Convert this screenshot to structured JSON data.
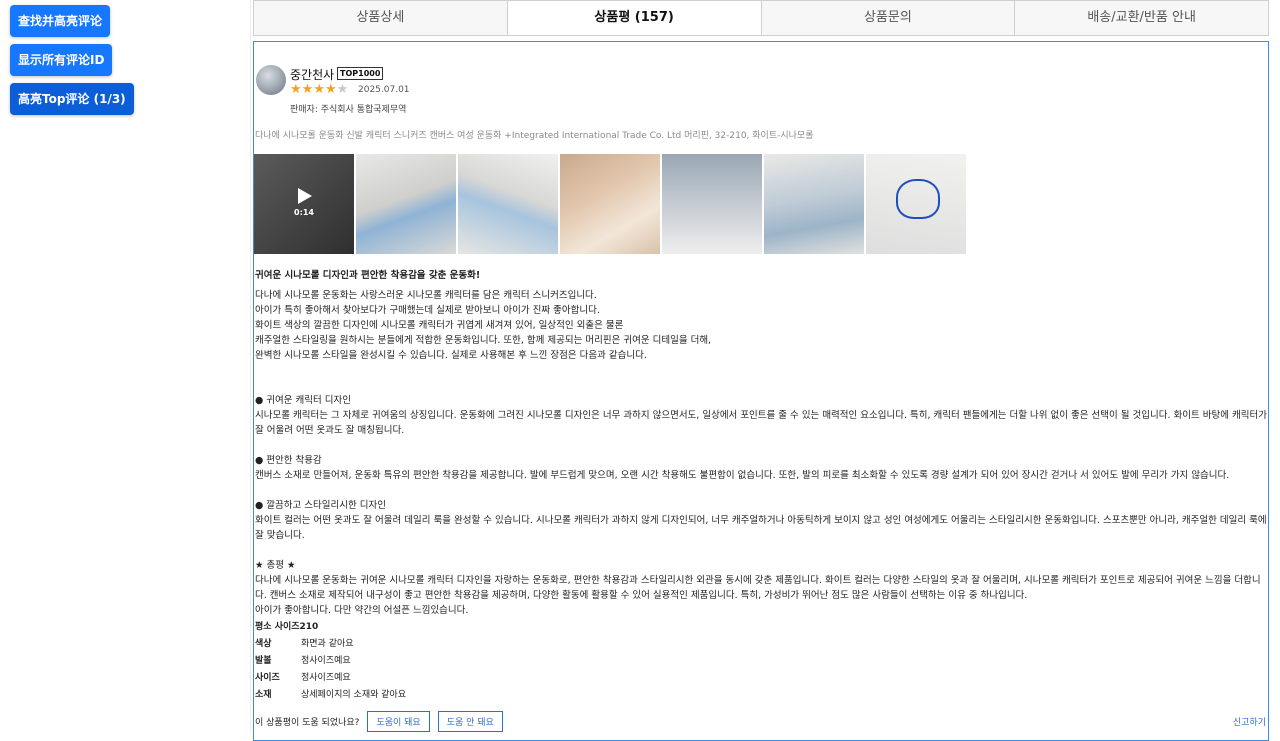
{
  "toolbar": {
    "find_btn": "查找并高亮评论",
    "show_ids_btn": "显示所有评论ID",
    "top_btn": "高亮Top评论 (1/3)"
  },
  "tabs": [
    {
      "label": "상품상세"
    },
    {
      "label": "상품평 (157)"
    },
    {
      "label": "상품문의"
    },
    {
      "label": "배송/교환/반품 안내"
    }
  ],
  "review": {
    "author": "중간천사",
    "badge": "TOP1000",
    "rating": 4,
    "date": "2025.07.01",
    "seller": "판매자: 주식회사 통합국제무역",
    "product_option": "다나에 시나모롤 운동화 신발 캐릭터 스니커즈 캔버스 여성 운동화 +Integrated International Trade Co. Ltd 머리핀, 32-210, 화이트-시나모롤",
    "video_time": "0:14",
    "headline": "귀여운 시나모롤 디자인과 편안한 착용감을 갖춘 운동화!",
    "body": "다나에 시나모롤 운동화는 사랑스러운 시나모롤 캐릭터를 담은 캐릭터 스니커즈입니다.\n아이가 특히 좋아해서 찾아보다가 구매했는데 실제로 받아보니 아이가 진짜 좋아합니다.\n화이트 색상의 깔끔한 디자인에 시나모롤 캐릭터가 귀엽게 새겨져 있어, 일상적인 외출은 물론\n캐주얼한 스타일링을 원하시는 분들에게 적합한 운동화입니다. 또한, 함께 제공되는 머리핀은 귀여운 디테일을 더해,\n완벽한 시나모롤 스타일을 완성시킬 수 있습니다. 실제로 사용해본 후 느낀 장점은 다음과 같습니다.\n\n\n● 귀여운 캐릭터 디자인\n시나모롤 캐릭터는 그 자체로 귀여움의 상징입니다. 운동화에 그려진 시나모롤 디자인은 너무 과하지 않으면서도, 일상에서 포인트를 줄 수 있는 매력적인 요소입니다. 특히, 캐릭터 팬들에게는 더할 나위 없이 좋은 선택이 될 것입니다. 화이트 바탕에 캐릭터가 잘 어울려 어떤 옷과도 잘 매칭됩니다.\n\n● 편안한 착용감\n캔버스 소재로 만들어져, 운동화 특유의 편안한 착용감을 제공합니다. 발에 부드럽게 맞으며, 오랜 시간 착용해도 불편함이 없습니다. 또한, 발의 피로를 최소화할 수 있도록 경량 설계가 되어 있어 장시간 걷거나 서 있어도 발에 무리가 가지 않습니다.\n\n● 깔끔하고 스타일리시한 디자인\n화이트 컬러는 어떤 옷과도 잘 어울려 데일리 룩을 완성할 수 있습니다. 시나모롤 캐릭터가 과하지 않게 디자인되어, 너무 캐주얼하거나 아동틱하게 보이지 않고 성인 여성에게도 어울리는 스타일리시한 운동화입니다. 스포츠뿐만 아니라, 캐주얼한 데일리 룩에 잘 맞습니다.\n\n★ 총평 ★\n다나에 시나모롤 운동화는 귀여운 시나모롤 캐릭터 디자인을 자랑하는 운동화로, 편안한 착용감과 스타일리시한 외관을 동시에 갖춘 제품입니다. 화이트 컬러는 다양한 스타일의 옷과 잘 어울리며, 시나모롤 캐릭터가 포인트로 제공되어 귀여운 느낌을 더합니다. 캔버스 소재로 제작되어 내구성이 좋고 편안한 착용감을 제공하며, 다양한 활동에 활용할 수 있어 실용적인 제품입니다. 특히, 가성비가 뛰어난 점도 많은 사람들이 선택하는 이유 중 하나입니다.\n아이가 좋아합니다. 다만 약간의 어설픈 느낌있습니다.",
    "size_line": "평소 사이즈210",
    "attributes": [
      {
        "key": "색상",
        "value": "화면과 같아요"
      },
      {
        "key": "발볼",
        "value": "정사이즈예요"
      },
      {
        "key": "사이즈",
        "value": "정사이즈예요"
      },
      {
        "key": "소재",
        "value": "상세페이지의 소재와 같아요"
      }
    ],
    "helpful_question": "이 상품평이 도움 되었나요?",
    "helpful_yes": "도움이 돼요",
    "helpful_no": "도움 안 돼요",
    "report": "신고하기"
  }
}
